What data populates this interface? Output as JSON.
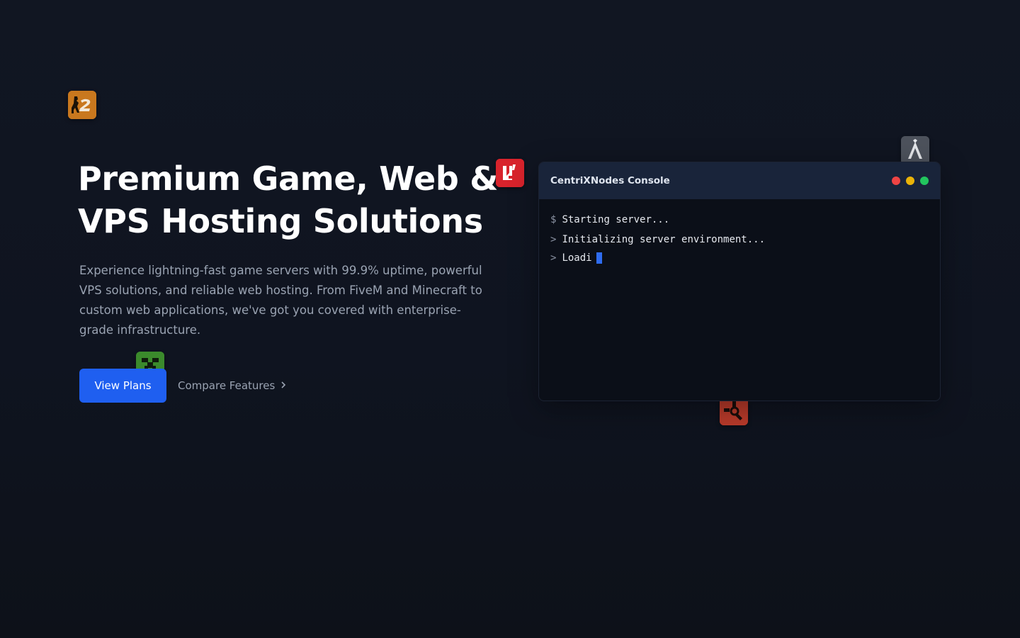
{
  "hero": {
    "title_line1": "Premium Game, Web &",
    "title_line2": "VPS Hosting Solutions",
    "subtitle": "Experience lightning-fast game servers with 99.9% uptime, powerful VPS solutions, and reliable web hosting. From FiveM and Minecraft to custom web applications, we've got you covered with enterprise-grade infrastructure.",
    "primary_button": "View Plans",
    "secondary_button": "Compare Features",
    "secondary_icon": "chevron-right-icon"
  },
  "console": {
    "title": "CentriXNodes Console",
    "window_controls": [
      "#ef4444",
      "#eab308",
      "#22c55e"
    ],
    "lines": [
      {
        "prompt": "$",
        "text": "Starting server..."
      },
      {
        "prompt": ">",
        "text": "Initializing server environment..."
      },
      {
        "prompt": ">",
        "text": "Loadi"
      }
    ],
    "cursor_color": "#2f6cf0"
  },
  "floating_icons": [
    {
      "name": "counter-strike-2-icon",
      "color": "#c9781e"
    },
    {
      "name": "fivem-icon",
      "color": "#e0242f"
    },
    {
      "name": "minecraft-creeper-icon",
      "color": "#3d8a2e"
    },
    {
      "name": "fivem-alt-icon",
      "color": "#4a4f59"
    },
    {
      "name": "rust-icon",
      "color": "#c0392b"
    }
  ],
  "colors": {
    "background": "#111622",
    "accent": "#1f5ff0",
    "muted_text": "#9aa3b2",
    "console_header": "#19243a"
  }
}
